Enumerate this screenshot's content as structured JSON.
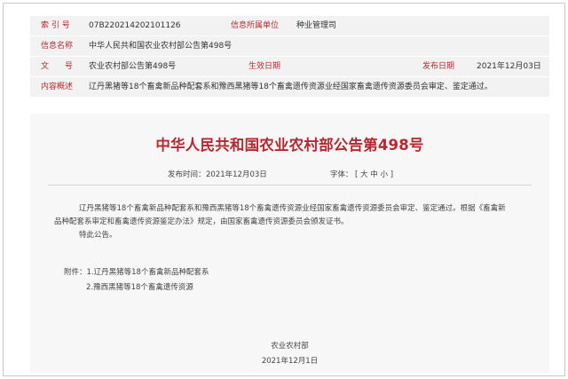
{
  "meta": {
    "index_label": "索 引 号",
    "index_value": "07B220214202101126",
    "org_label": "信息所属单位",
    "org_value": "种业管理司",
    "title_label": "信息名称",
    "title_value": "中华人民共和国农业农村部公告第498号",
    "doc_label": "文　　号",
    "doc_value": "农业农村部公告第498号",
    "effective_label": "生效日期",
    "issued_label": "发布日期",
    "issued_value": "2021年12月03日",
    "summary_label": "内容概述",
    "summary_value": "辽丹黑猪等18个畜禽新品种配套系和豫西黑猪等18个畜禽遗传资源业经国家畜禽遗传资源委员会审定、鉴定通过。"
  },
  "doc": {
    "title": "中华人民共和国农业农村部公告第498号",
    "publish_label": "发布时间：",
    "publish_date": "2021年12月03日",
    "font_label": "字体：",
    "font_open": "[",
    "font_large": "大",
    "font_medium": "中",
    "font_small": "小",
    "font_close": "]",
    "para1_line1": "辽丹黑猪等18个畜禽新品种配套系和豫西黑猪等18个畜禽遗传资源业经国家畜禽遗传资源委员会审定、鉴定通过。根据《畜禽新",
    "para1_line2": "品种配套系审定和畜禽遗传资源鉴定办法》规定，由国家畜禽遗传资源委员会颁发证书。",
    "para2": "特此公告。",
    "attach_label": "附件：",
    "attach_1": "1.辽丹黑猪等18个畜禽新品种配套系",
    "attach_2": "2.豫西黑猪等18个畜禽遗传资源",
    "sign_org": "农业农村部",
    "sign_date": "2021年12月1日"
  },
  "colors": {
    "accent": "#b5282f",
    "meta_bg": "#f2f2f2",
    "content_bg": "#f7f7f7"
  }
}
